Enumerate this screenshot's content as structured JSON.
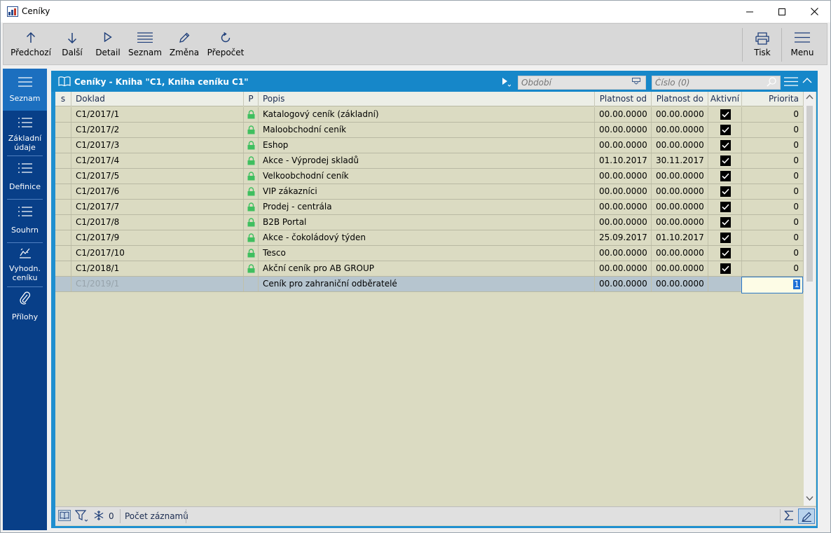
{
  "window": {
    "title": "Ceníky"
  },
  "toolbar": {
    "previous": "Předchozí",
    "next": "Další",
    "detail": "Detail",
    "list": "Seznam",
    "change": "Změna",
    "recalc": "Přepočet",
    "print": "Tisk",
    "menu": "Menu"
  },
  "nav": {
    "items": [
      {
        "l1": "Seznam",
        "l2": ""
      },
      {
        "l1": "Základní",
        "l2": "údaje"
      },
      {
        "l1": "Definice",
        "l2": ""
      },
      {
        "l1": "Souhrn",
        "l2": ""
      },
      {
        "l1": "Vyhodn.",
        "l2": "ceníku"
      },
      {
        "l1": "Přílohy",
        "l2": ""
      }
    ]
  },
  "grid": {
    "title": "Ceníky - Kniha \"C1, Kniha ceníku C1\"",
    "period_placeholder": "Období",
    "number_placeholder": "Číslo (0)",
    "columns": {
      "s": "s",
      "doc": "Doklad",
      "p": "P",
      "desc": "Popis",
      "from": "Platnost od",
      "to": "Platnost do",
      "active": "Aktivní",
      "priority": "Priorita"
    },
    "rows": [
      {
        "doc": "C1/2017/1",
        "desc": "Katalogový ceník (základní)",
        "from": "00.00.0000",
        "to": "00.00.0000",
        "priority": "0",
        "locked": true,
        "active": true
      },
      {
        "doc": "C1/2017/2",
        "desc": "Maloobchodní ceník",
        "from": "00.00.0000",
        "to": "00.00.0000",
        "priority": "0",
        "locked": true,
        "active": true
      },
      {
        "doc": "C1/2017/3",
        "desc": "Eshop",
        "from": "00.00.0000",
        "to": "00.00.0000",
        "priority": "0",
        "locked": true,
        "active": true
      },
      {
        "doc": "C1/2017/4",
        "desc": "Akce - Výprodej skladů",
        "from": "01.10.2017",
        "to": "30.11.2017",
        "priority": "0",
        "locked": true,
        "active": true
      },
      {
        "doc": "C1/2017/5",
        "desc": "Velkoobchodní ceník",
        "from": "00.00.0000",
        "to": "00.00.0000",
        "priority": "0",
        "locked": true,
        "active": true
      },
      {
        "doc": "C1/2017/6",
        "desc": "VIP zákazníci",
        "from": "00.00.0000",
        "to": "00.00.0000",
        "priority": "0",
        "locked": true,
        "active": true
      },
      {
        "doc": "C1/2017/7",
        "desc": "Prodej - centrála",
        "from": "00.00.0000",
        "to": "00.00.0000",
        "priority": "0",
        "locked": true,
        "active": true
      },
      {
        "doc": "C1/2017/8",
        "desc": "B2B Portal",
        "from": "00.00.0000",
        "to": "00.00.0000",
        "priority": "0",
        "locked": true,
        "active": true
      },
      {
        "doc": "C1/2017/9",
        "desc": "Akce - čokoládový týden",
        "from": "25.09.2017",
        "to": "01.10.2017",
        "priority": "0",
        "locked": true,
        "active": true
      },
      {
        "doc": "C1/2017/10",
        "desc": "Tesco",
        "from": "00.00.0000",
        "to": "00.00.0000",
        "priority": "0",
        "locked": true,
        "active": true
      },
      {
        "doc": "C1/2018/1",
        "desc": "Akční ceník pro AB GROUP",
        "from": "00.00.0000",
        "to": "00.00.0000",
        "priority": "0",
        "locked": true,
        "active": true
      },
      {
        "doc": "C1/2019/1",
        "desc": "Ceník pro zahraniční odběratelé",
        "from": "00.00.0000",
        "to": "00.00.0000",
        "priority": "1",
        "locked": false,
        "active": false,
        "selected": true
      }
    ]
  },
  "status": {
    "count": "0",
    "label": "Počet záznamů"
  },
  "colors": {
    "nav_bg": "#083f88",
    "panel_header": "#1687c9",
    "grid_bg": "#dbdbc2",
    "lock": "#3fbf5f"
  }
}
